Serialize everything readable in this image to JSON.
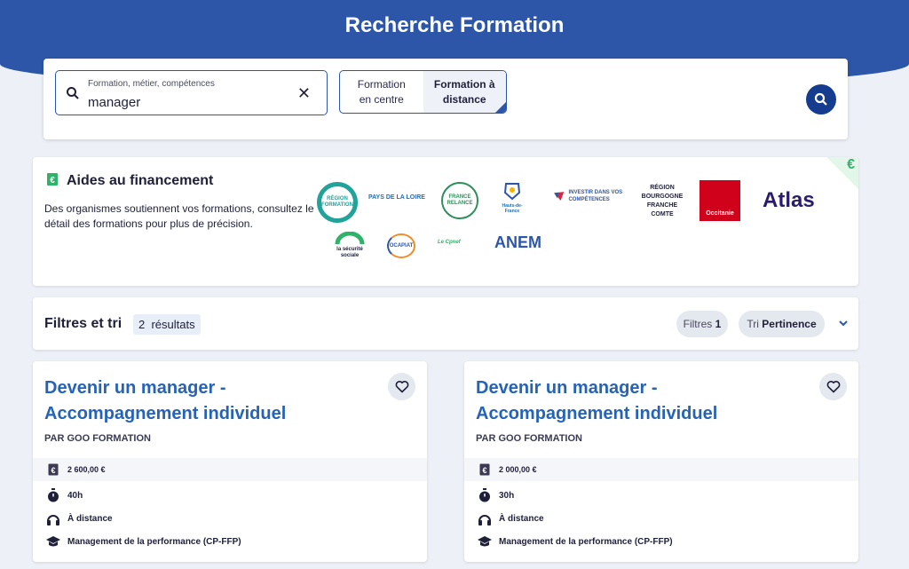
{
  "page": {
    "title": "Recherche Formation"
  },
  "search": {
    "label": "Formation, métier, compétences",
    "value": "manager",
    "modes": [
      "Formation en centre",
      "Formation à distance"
    ],
    "mode_line1": [
      "Formation",
      "en centre"
    ],
    "mode_line2": [
      "Formation à",
      "distance"
    ]
  },
  "aides": {
    "title": "Aides au financement",
    "description": "Des organismes soutiennent vos formations, consultez le détail des formations pour plus de précision.",
    "logos": [
      "RÉGION FORMATION",
      "PAYS DE LA LOIRE",
      "FRANCE RELANCE",
      "Hauts-de-France",
      "INVESTIR DANS VOS COMPÉTENCES",
      "RÉGION BOURGOGNE FRANCHE COMTE",
      "Occitanie",
      "Atlas",
      "la sécurité sociale",
      "OCAPIAT",
      "Le Cpnef",
      "ANEM"
    ],
    "corner_icon": "euro-icon"
  },
  "filters": {
    "title": "Filtres et tri",
    "count": "2",
    "count_label": "résultats",
    "filter_label": "Filtres",
    "filter_count": "1",
    "sort_label": "Tri",
    "sort_value": "Pertinence"
  },
  "results": [
    {
      "title": "Devenir un manager - Accompagnement individuel",
      "provider": "PAR GOO FORMATION",
      "price": "2 600,00 €",
      "duration": "40h",
      "mode": "À distance",
      "certification": "Management de la performance (CP-FFP)"
    },
    {
      "title": "Devenir un manager - Accompagnement individuel",
      "provider": "PAR GOO FORMATION",
      "price": "2 000,00 €",
      "duration": "30h",
      "mode": "À distance",
      "certification": "Management de la performance (CP-FFP)"
    }
  ],
  "colors": {
    "brand": "#2d56a8",
    "link": "#2563b8",
    "button": "#153c8f",
    "accent_green": "#2fb36a"
  }
}
